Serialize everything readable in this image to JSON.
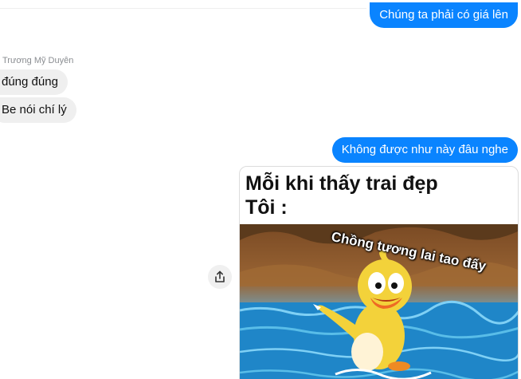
{
  "messages": {
    "out_1": "Chúng ta phải có giá lên",
    "sender_name": "Trương Mỹ Duyên",
    "in_1": "đúng đúng",
    "in_2": "Be nói chí lý",
    "out_2": "Không được như này đâu nghe"
  },
  "meme": {
    "caption_line1": "Mỗi khi thấy trai đẹp",
    "caption_line2": "Tôi :",
    "overlay_text": "Chồng tương lai tao đấy"
  },
  "icons": {
    "share": "share-icon"
  },
  "colors": {
    "outgoing_bubble": "#0a84ff",
    "incoming_bubble": "#efefef"
  }
}
